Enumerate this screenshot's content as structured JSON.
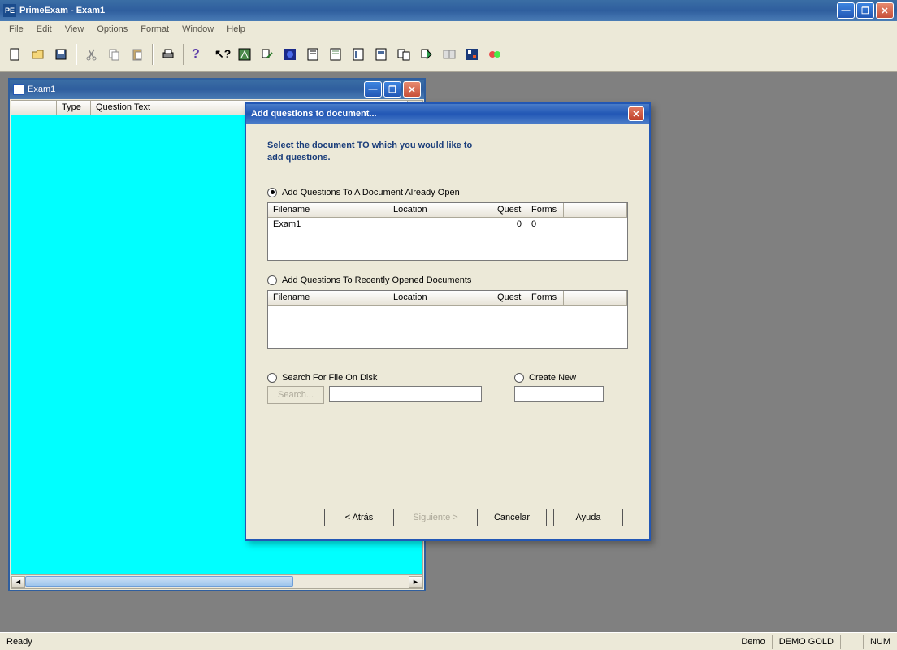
{
  "app": {
    "title": "PrimeExam - Exam1"
  },
  "menu": {
    "file": "File",
    "edit": "Edit",
    "view": "View",
    "options": "Options",
    "format": "Format",
    "window": "Window",
    "help": "Help"
  },
  "child": {
    "title": "Exam1",
    "columns": {
      "blank": "",
      "type": "Type",
      "qtext": "Question Text"
    }
  },
  "dialog": {
    "title": "Add questions to document...",
    "heading1": "Select the document TO which you would like to",
    "heading2": "add questions.",
    "opt_already_open": "Add Questions To A Document Already Open",
    "opt_recent": "Add Questions To Recently Opened Documents",
    "opt_search": "Search For File On Disk",
    "opt_create": "Create New",
    "search_btn": "Search...",
    "table_hdr": {
      "filename": "Filename",
      "location": "Location",
      "quest": "Quest",
      "forms": "Forms"
    },
    "open_docs": [
      {
        "filename": "Exam1",
        "location": "",
        "quest": "0",
        "forms": "0"
      }
    ],
    "buttons": {
      "back": "< Atrás",
      "next": "Siguiente >",
      "cancel": "Cancelar",
      "help": "Ayuda"
    }
  },
  "status": {
    "ready": "Ready",
    "demo": "Demo",
    "demogold": "DEMO GOLD",
    "num": "NUM"
  }
}
